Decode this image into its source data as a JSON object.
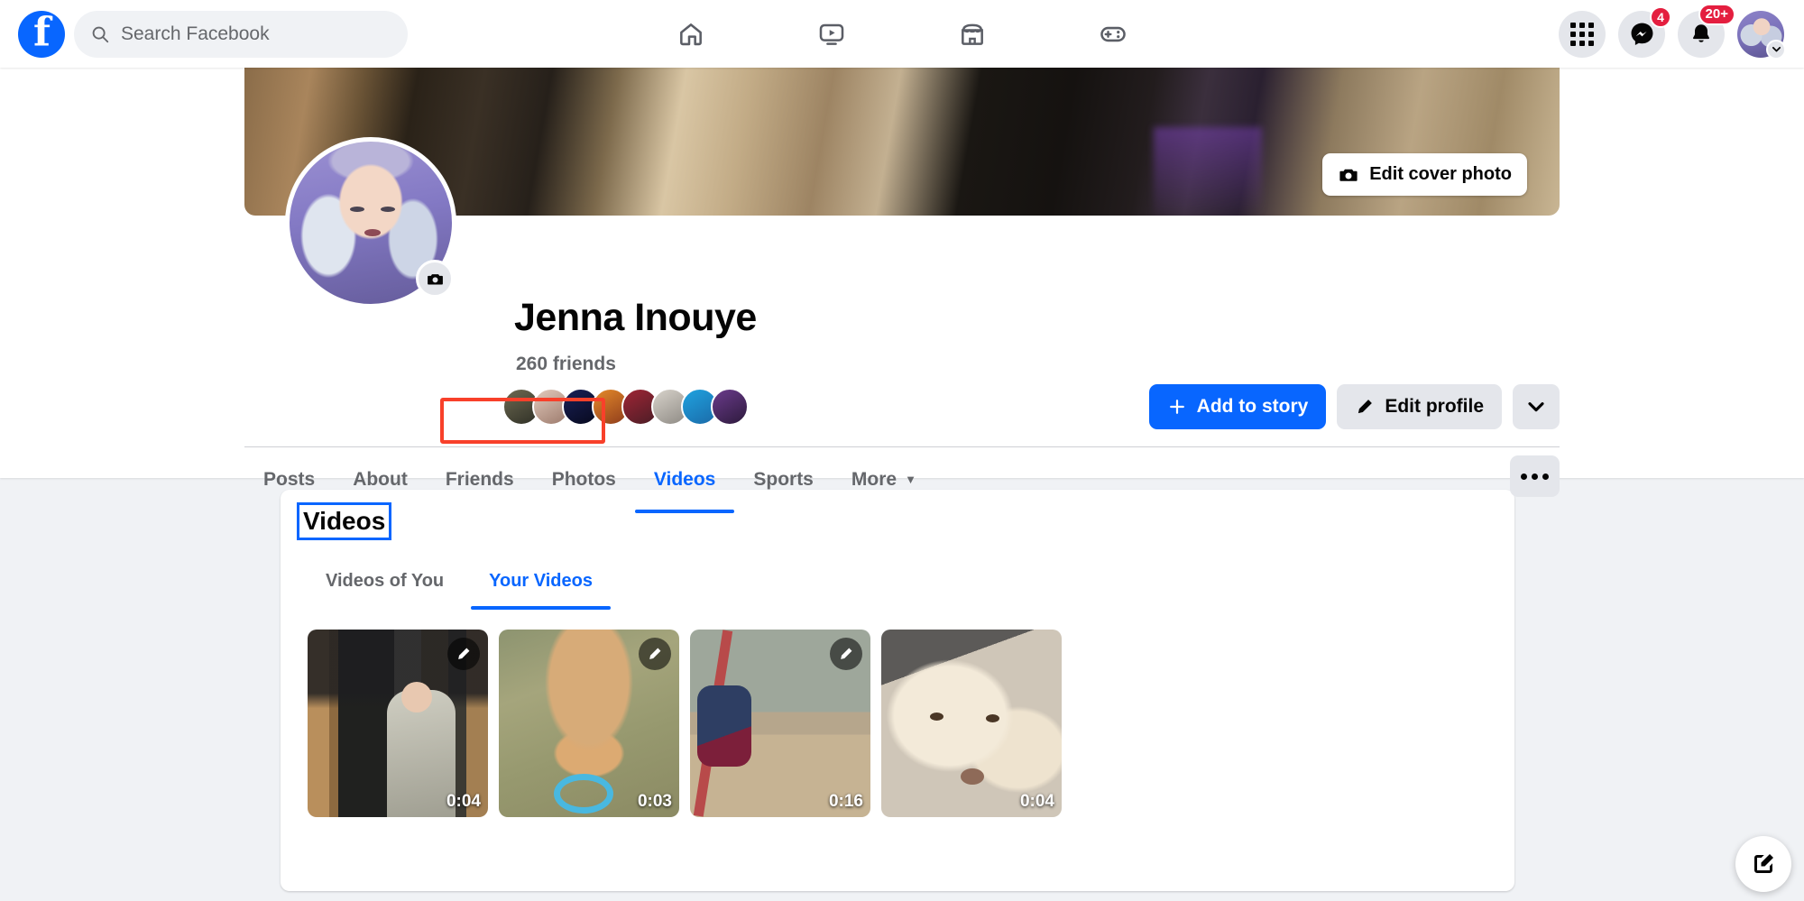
{
  "topnav": {
    "logo_icon": "facebook-logo-icon",
    "search": {
      "placeholder": "Search Facebook",
      "value": "",
      "icon": "search-icon"
    },
    "center_tabs": [
      {
        "name": "home",
        "icon": "home-icon"
      },
      {
        "name": "video",
        "icon": "video-play-icon"
      },
      {
        "name": "marketplace",
        "icon": "storefront-icon"
      },
      {
        "name": "gaming",
        "icon": "gamepad-icon"
      }
    ],
    "right": {
      "menu_icon": "grid-menu-icon",
      "messenger": {
        "icon": "messenger-icon",
        "badge": "4"
      },
      "notifications": {
        "icon": "bell-icon",
        "badge": "20+"
      },
      "account": {
        "icon": "profile-avatar",
        "chevron": "chevron-down-icon"
      }
    }
  },
  "profile": {
    "name": "Jenna Inouye",
    "friends_count": "260 friends",
    "cover": {
      "edit_label": "Edit cover photo",
      "icon": "camera-icon"
    },
    "photo_edit_icon": "camera-icon",
    "friend_thumbs": [
      "#4a4a42",
      "#c9b3a8",
      "#141a44",
      "#c06a2a",
      "#7b1f2a",
      "#b8b4ae",
      "#1d7bbf",
      "#4b2a63"
    ],
    "actions": {
      "add_story": {
        "label": "Add to story",
        "icon": "plus-icon"
      },
      "edit_profile": {
        "label": "Edit profile",
        "icon": "pencil-icon"
      },
      "more": {
        "icon": "chevron-down-icon"
      }
    },
    "tabs": [
      {
        "label": "Posts",
        "active": false
      },
      {
        "label": "About",
        "active": false
      },
      {
        "label": "Friends",
        "active": false
      },
      {
        "label": "Photos",
        "active": false
      },
      {
        "label": "Videos",
        "active": true
      },
      {
        "label": "Sports",
        "active": false
      },
      {
        "label": "More",
        "active": false,
        "caret": "▼"
      }
    ],
    "tabs_more_icon": "ellipsis-icon",
    "highlight_color": "#f8402a"
  },
  "videos_card": {
    "title": "Videos",
    "subtabs": [
      {
        "label": "Videos of You",
        "active": false
      },
      {
        "label": "Your Videos",
        "active": true
      }
    ],
    "items": [
      {
        "duration": "0:04",
        "edit_icon": "pencil-icon",
        "has_edit": true,
        "alt": "person drinking in cabin"
      },
      {
        "duration": "0:03",
        "edit_icon": "pencil-icon",
        "has_edit": true,
        "alt": "dog with blue toy in grass"
      },
      {
        "duration": "0:16",
        "edit_icon": "pencil-icon",
        "has_edit": true,
        "alt": "playground swings in woods"
      },
      {
        "duration": "0:04",
        "edit_icon": "pencil-icon",
        "has_edit": false,
        "alt": "white dog close up"
      }
    ]
  },
  "fab": {
    "icon": "compose-icon"
  },
  "colors": {
    "accent": "#0866ff",
    "badge": "#e41e3f",
    "chrome": "#e4e6eb",
    "page_bg": "#f0f2f5"
  }
}
